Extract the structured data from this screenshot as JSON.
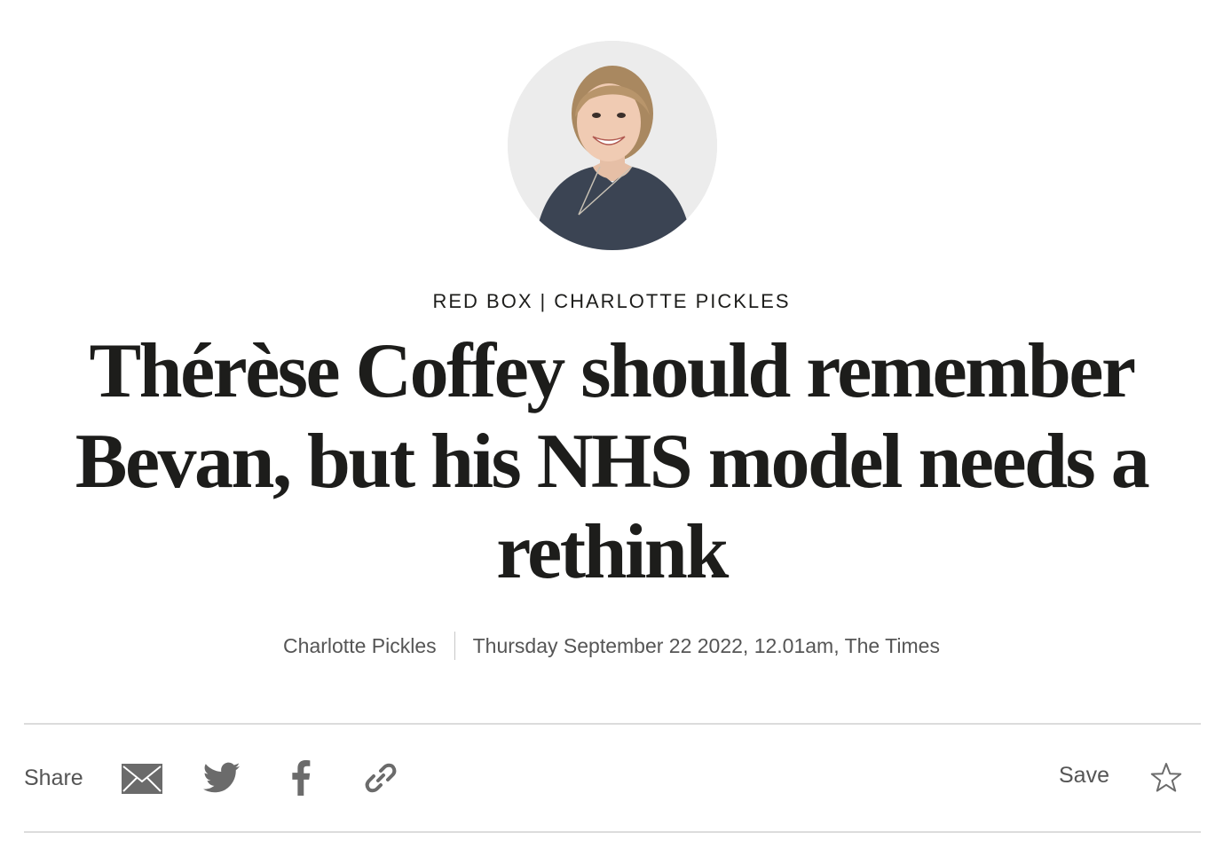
{
  "article": {
    "section": "RED BOX",
    "section_separator": "|",
    "author_tag": "CHARLOTTE PICKLES",
    "headline_lines": [
      "Thérèse Coffey should remember",
      "Bevan, but his NHS model needs a",
      "rethink"
    ],
    "byline": {
      "author": "Charlotte Pickles",
      "dateline": "Thursday September 22 2022, 12.01am, The Times"
    }
  },
  "share_bar": {
    "share_label": "Share",
    "save_label": "Save",
    "icons": [
      "email-icon",
      "twitter-icon",
      "facebook-icon",
      "link-icon",
      "star-icon"
    ]
  },
  "colors": {
    "text": "#1d1d1b",
    "meta_text": "#555555",
    "icon": "#6b6b6b",
    "rule": "#dcdcdc",
    "avatar_bg": "#ececec"
  }
}
